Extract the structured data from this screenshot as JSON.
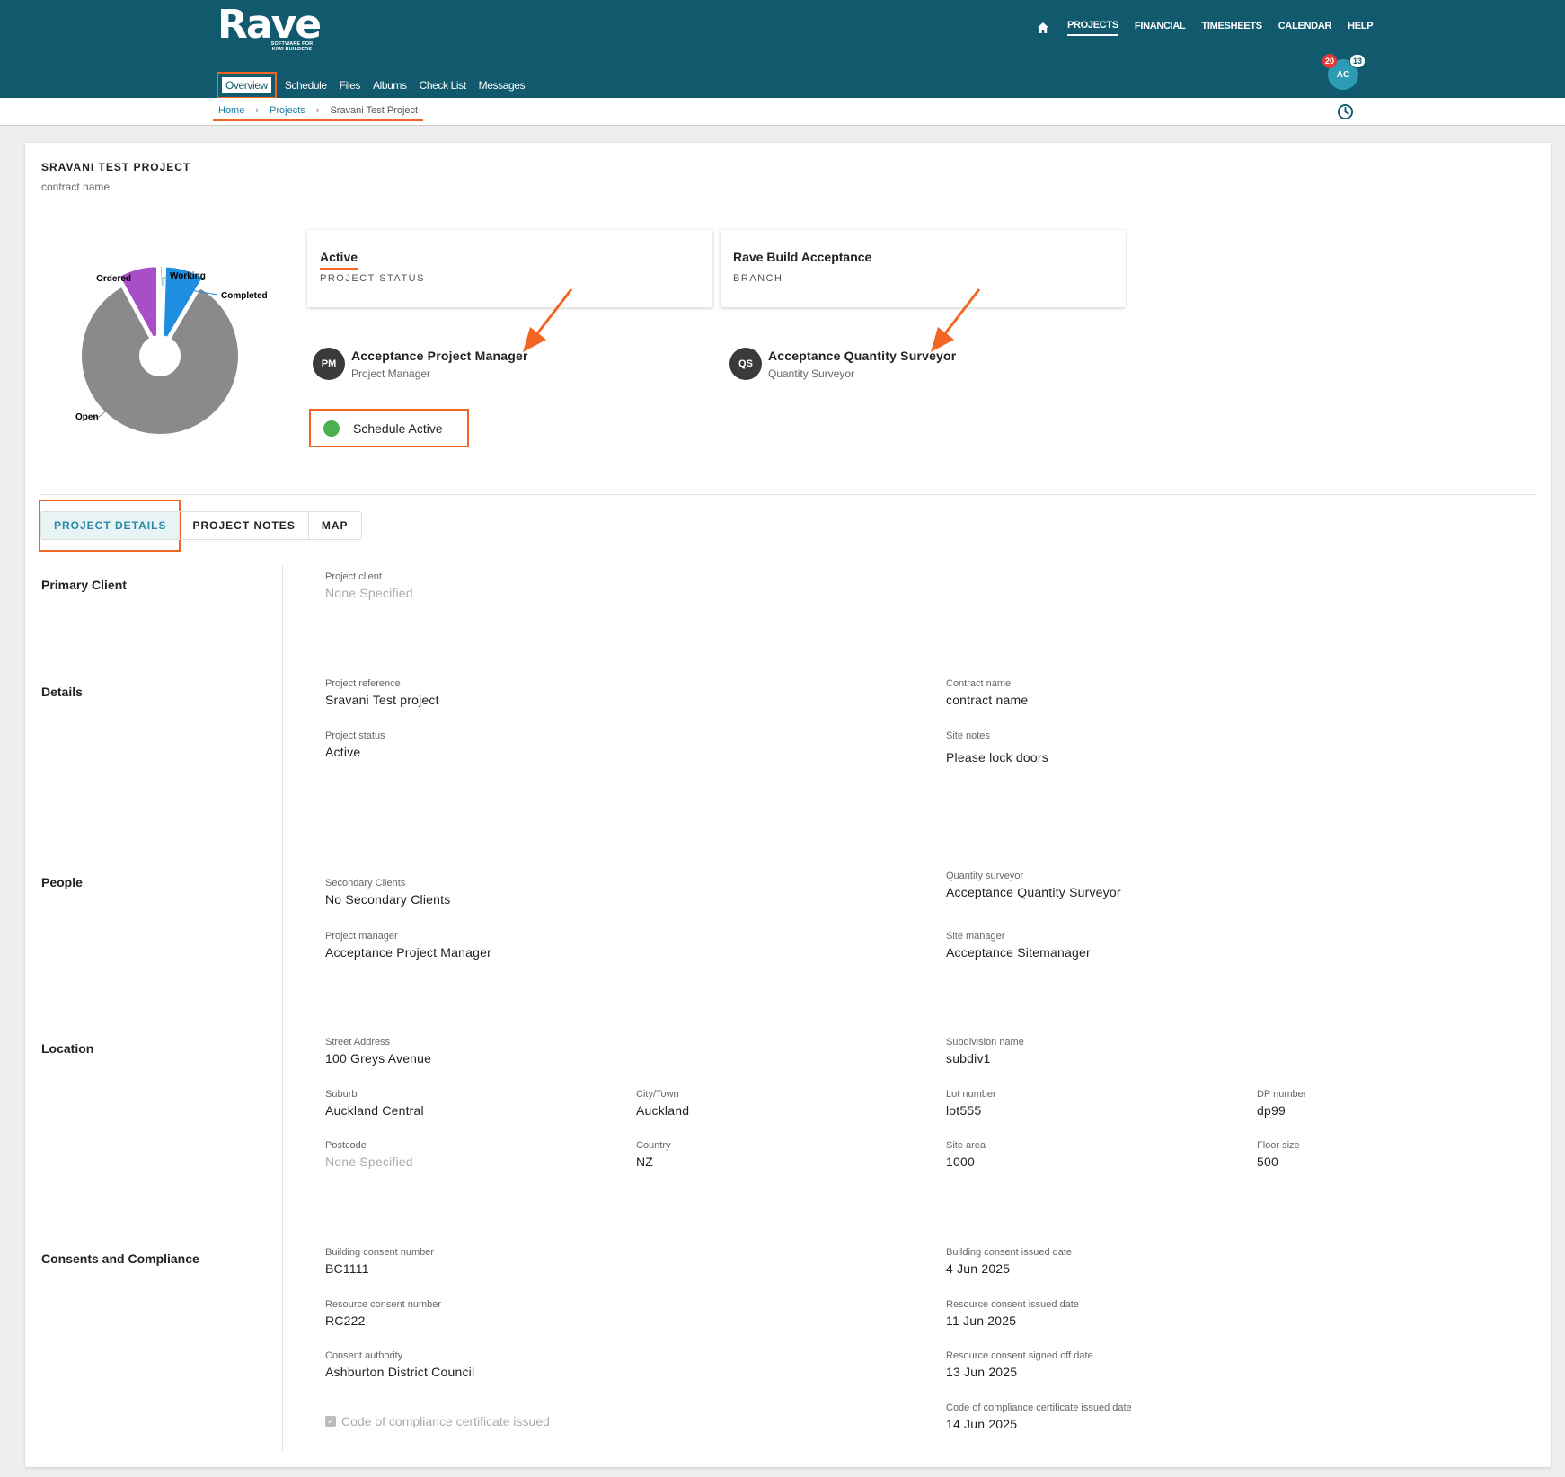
{
  "header": {
    "logo": "Rave",
    "logo_sub": "SOFTWARE FOR KIWI BUILDERS",
    "nav": [
      "PROJECTS",
      "FINANCIAL",
      "TIMESHEETS",
      "CALENDAR",
      "HELP"
    ],
    "user_initials": "AC",
    "badge_alerts": "20",
    "badge_messages": "13"
  },
  "subnav": [
    "Overview",
    "Schedule",
    "Files",
    "Albums",
    "Check List",
    "Messages"
  ],
  "breadcrumb": {
    "home": "Home",
    "projects": "Projects",
    "current": "Sravani Test Project"
  },
  "project": {
    "title": "SRAVANI TEST PROJECT",
    "subtitle": "contract name"
  },
  "chart_data": {
    "type": "pie",
    "labels": [
      "Ordered",
      "Working",
      "Completed",
      "Open"
    ],
    "values": [
      8,
      0.5,
      8,
      83.5
    ],
    "colors": [
      "#a94fc5",
      "#4fb7b0",
      "#1e8fe0",
      "#8a8a8a"
    ]
  },
  "tiles": {
    "status_value": "Active",
    "status_label": "PROJECT STATUS",
    "branch_value": "Rave Build Acceptance",
    "branch_label": "BRANCH"
  },
  "people": {
    "pm_initials": "PM",
    "pm_name": "Acceptance Project Manager",
    "pm_role": "Project Manager",
    "qs_initials": "QS",
    "qs_name": "Acceptance Quantity Surveyor",
    "qs_role": "Quantity Surveyor"
  },
  "schedule_status": "Schedule Active",
  "tabs": [
    "PROJECT DETAILS",
    "PROJECT NOTES",
    "MAP"
  ],
  "sections": {
    "primary_client": "Primary Client",
    "details": "Details",
    "people": "People",
    "location": "Location",
    "consents": "Consents and Compliance"
  },
  "fields": {
    "project_client": {
      "label": "Project client",
      "value": "None Specified"
    },
    "project_reference": {
      "label": "Project reference",
      "value": "Sravani Test project"
    },
    "contract_name": {
      "label": "Contract name",
      "value": "contract name"
    },
    "project_status": {
      "label": "Project status",
      "value": "Active"
    },
    "site_notes": {
      "label": "Site notes",
      "value": "Please lock doors"
    },
    "secondary_clients": {
      "label": "Secondary Clients",
      "value": "No Secondary Clients"
    },
    "quantity_surveyor": {
      "label": "Quantity surveyor",
      "value": "Acceptance Quantity Surveyor"
    },
    "project_manager": {
      "label": "Project manager",
      "value": "Acceptance Project Manager"
    },
    "site_manager": {
      "label": "Site manager",
      "value": "Acceptance Sitemanager"
    },
    "street_address": {
      "label": "Street Address",
      "value": "100 Greys Avenue"
    },
    "subdivision_name": {
      "label": "Subdivision name",
      "value": "subdiv1"
    },
    "suburb": {
      "label": "Suburb",
      "value": "Auckland Central"
    },
    "city": {
      "label": "City/Town",
      "value": "Auckland"
    },
    "lot_number": {
      "label": "Lot number",
      "value": "lot555"
    },
    "dp_number": {
      "label": "DP number",
      "value": "dp99"
    },
    "postcode": {
      "label": "Postcode",
      "value": "None Specified"
    },
    "country": {
      "label": "Country",
      "value": "NZ"
    },
    "site_area": {
      "label": "Site area",
      "value": "1000"
    },
    "floor_size": {
      "label": "Floor size",
      "value": "500"
    },
    "building_consent_number": {
      "label": "Building consent number",
      "value": "BC1111"
    },
    "building_consent_date": {
      "label": "Building consent issued date",
      "value": "4 Jun 2025"
    },
    "resource_consent_number": {
      "label": "Resource consent number",
      "value": "RC222"
    },
    "resource_consent_date": {
      "label": "Resource consent issued date",
      "value": "11 Jun 2025"
    },
    "consent_authority": {
      "label": "Consent authority",
      "value": "Ashburton District Council"
    },
    "resource_signed_off": {
      "label": "Resource consent signed off date",
      "value": "13 Jun 2025"
    },
    "ccc_date": {
      "label": "Code of compliance certificate issued date",
      "value": "14 Jun 2025"
    }
  },
  "ccc_checkbox": "Code of compliance certificate issued"
}
